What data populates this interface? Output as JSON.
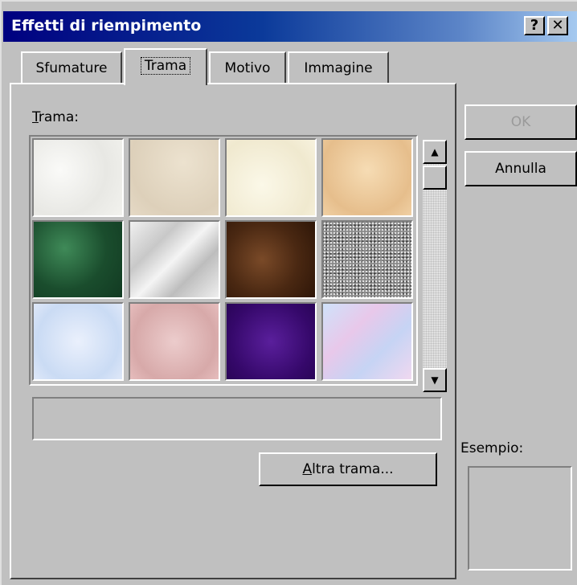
{
  "window": {
    "title": "Effetti di riempimento",
    "help_label": "?",
    "close_label": "✕"
  },
  "tabs": [
    {
      "label": "Sfumature",
      "active": false
    },
    {
      "label": "Trama",
      "active": true
    },
    {
      "label": "Motivo",
      "active": false
    },
    {
      "label": "Immagine",
      "active": false
    }
  ],
  "texture_panel": {
    "label_mnemonic": "T",
    "label_rest": "rama:",
    "textures": [
      {
        "name": "white-paper",
        "color": "#eeeeea"
      },
      {
        "name": "beige-paper",
        "color": "#e2d6c3"
      },
      {
        "name": "cream-parchment",
        "color": "#f4efd8"
      },
      {
        "name": "tan-parchment",
        "color": "#ecc89a"
      },
      {
        "name": "green-marble",
        "color": "#1f5a35"
      },
      {
        "name": "white-marble",
        "color": "#dcdcdc"
      },
      {
        "name": "brown-marble",
        "color": "#4c2a16"
      },
      {
        "name": "granite",
        "color": "#8a8a8a"
      },
      {
        "name": "blue-tissue",
        "color": "#d4e2f6"
      },
      {
        "name": "pink-tissue",
        "color": "#e0b8b8"
      },
      {
        "name": "purple-mesh",
        "color": "#3e0f78"
      },
      {
        "name": "bouquet",
        "color": "#d2c2ec"
      }
    ],
    "scroll_up": "▲",
    "scroll_down": "▼",
    "more_mnemonic": "A",
    "more_rest": "ltra trama..."
  },
  "buttons": {
    "ok": "OK",
    "cancel": "Annulla"
  },
  "example": {
    "label": "Esempio:"
  }
}
